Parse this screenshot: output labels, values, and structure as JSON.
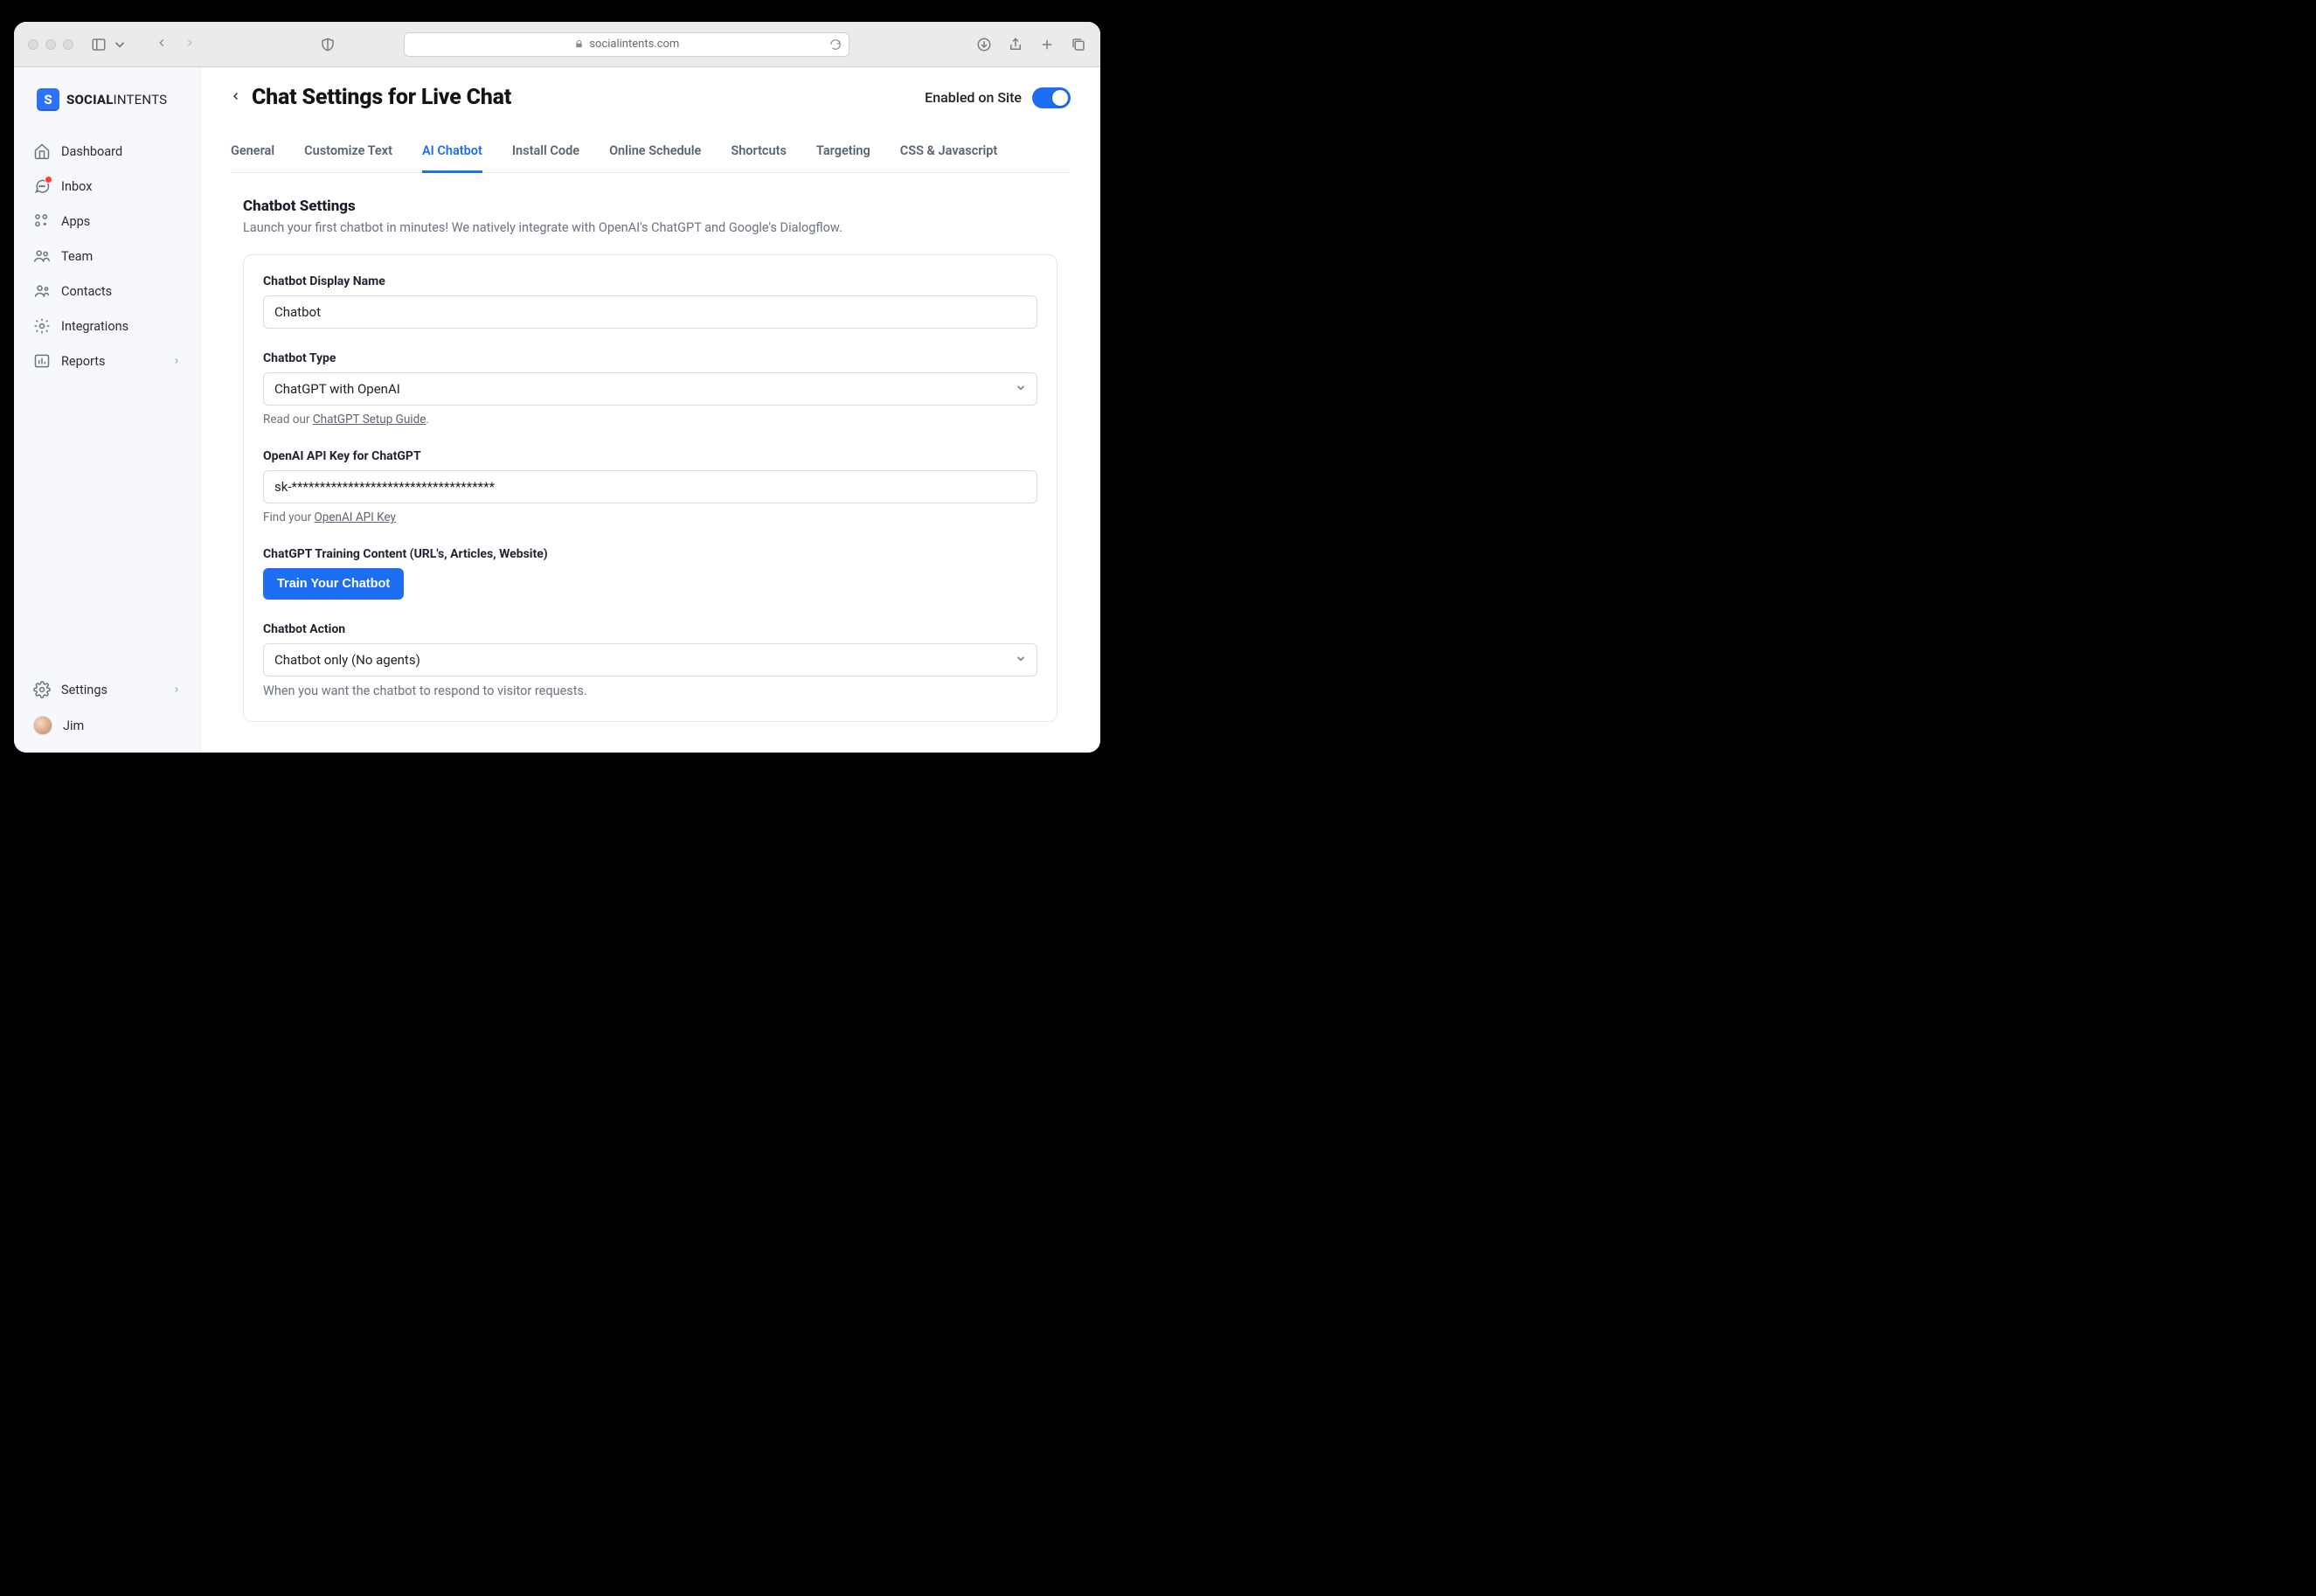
{
  "browser": {
    "url": "socialintents.com"
  },
  "logo": {
    "bold": "SOCIAL",
    "light": "INTENTS",
    "badge": "S"
  },
  "sidebar": {
    "items": [
      {
        "label": "Dashboard"
      },
      {
        "label": "Inbox"
      },
      {
        "label": "Apps"
      },
      {
        "label": "Team"
      },
      {
        "label": "Contacts"
      },
      {
        "label": "Integrations"
      },
      {
        "label": "Reports"
      }
    ],
    "settings_label": "Settings",
    "user_name": "Jim"
  },
  "page": {
    "title": "Chat Settings for Live Chat",
    "enabled_label": "Enabled on Site"
  },
  "tabs": [
    "General",
    "Customize Text",
    "AI Chatbot",
    "Install Code",
    "Online Schedule",
    "Shortcuts",
    "Targeting",
    "CSS & Javascript"
  ],
  "active_tab": "AI Chatbot",
  "section": {
    "heading": "Chatbot Settings",
    "subheading": "Launch your first chatbot in minutes! We natively integrate with OpenAI's ChatGPT and Google's Dialogflow."
  },
  "form": {
    "display_name": {
      "label": "Chatbot Display Name",
      "value": "Chatbot"
    },
    "chatbot_type": {
      "label": "Chatbot Type",
      "value": "ChatGPT with OpenAI",
      "helper_prefix": "Read our ",
      "helper_link": "ChatGPT Setup Guide",
      "helper_suffix": "."
    },
    "api_key": {
      "label": "OpenAI API Key for ChatGPT",
      "value": "sk-************************************",
      "helper_prefix": "Find your ",
      "helper_link": "OpenAI API Key"
    },
    "training": {
      "label": "ChatGPT Training Content (URL's, Articles, Website)",
      "button": "Train Your Chatbot"
    },
    "action": {
      "label": "Chatbot Action",
      "value": "Chatbot only (No agents)",
      "helper": "When you want the chatbot to respond to visitor requests."
    }
  }
}
